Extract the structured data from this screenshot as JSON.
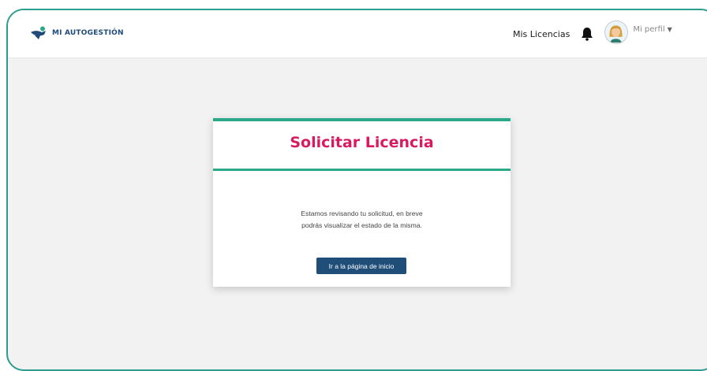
{
  "navbar": {
    "brand_text": "MI AUTOGESTIÓN",
    "links": {
      "licencias": "Mis Licencias"
    },
    "profile_label": "Mi perfil",
    "icons": {
      "brand": "logo-icon",
      "notifications": "bell-icon",
      "avatar": "avatar",
      "caret": "caret-down-icon"
    }
  },
  "card": {
    "title": "Solicitar Licencia",
    "message_line1": "Estamos revisando tu solicitud, en breve",
    "message_line2": "podrás visualizar el estado de la misma.",
    "button_label": "Ir a la página de inicio"
  },
  "colors": {
    "accent": "#2aa88a",
    "title": "#d81b60",
    "button": "#1f4e79",
    "brand": "#1f4b7a",
    "background": "#f2f2f2"
  }
}
